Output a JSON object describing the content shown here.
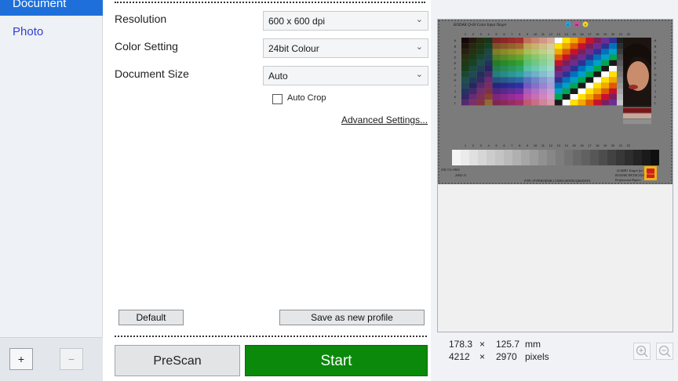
{
  "sidebar": {
    "items": [
      {
        "label": "Document",
        "selected": true
      },
      {
        "label": "Photo",
        "selected": false
      }
    ],
    "add_label": "+",
    "remove_label": "−"
  },
  "settings": {
    "resolution": {
      "label": "Resolution",
      "value": "600 x 600 dpi"
    },
    "color": {
      "label": "Color Setting",
      "value": "24bit Colour"
    },
    "docsize": {
      "label": "Document Size",
      "value": "Auto"
    },
    "auto_crop": {
      "label": "Auto Crop",
      "checked": false
    },
    "advanced_label": "Advanced Settings..."
  },
  "buttons": {
    "default_label": "Default",
    "save_profile_label": "Save as new profile",
    "prescan_label": "PreScan",
    "start_label": "Start"
  },
  "preview": {
    "target_title": "KODAK Q-60 Color Input Target",
    "cmy": [
      "C",
      "M",
      "Y"
    ],
    "col_numbers": [
      "1",
      "2",
      "3",
      "4",
      "5",
      "6",
      "7",
      "8",
      "9",
      "10",
      "11",
      "12",
      "13",
      "14",
      "15",
      "16",
      "17",
      "18",
      "19",
      "20",
      "21",
      "22"
    ],
    "row_letters": [
      "A",
      "B",
      "C",
      "D",
      "E",
      "F",
      "G",
      "H",
      "I",
      "J",
      "K",
      "L"
    ],
    "bl_text1": "IT8.7/2-1993",
    "bl_text2": "2002:11",
    "bottom_center": "FTP://FTP.KODAK.COM/GASTDS/Q60DATA",
    "br_text1": "Q-60R1 Target for",
    "br_text2": "KODAK EKTACOLOR",
    "br_text3": "Professional Papers",
    "kodak_mark": "Kodak",
    "dims": {
      "mm_w": "178.3",
      "mm_h": "125.7",
      "mm_unit": "mm",
      "px_w": "4212",
      "px_h": "2970",
      "px_unit": "pixels",
      "times": "×"
    }
  },
  "colors": {
    "accent": "#1e6fd9",
    "start_green": "#0a890a",
    "photo_link": "#2f3fd0"
  }
}
